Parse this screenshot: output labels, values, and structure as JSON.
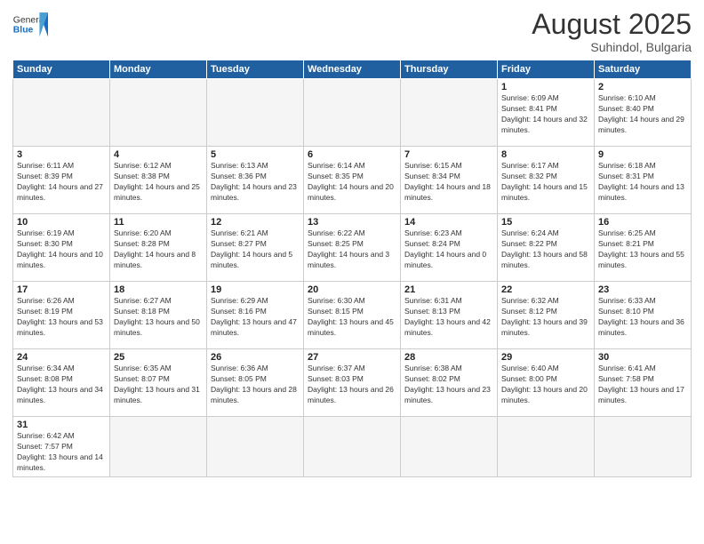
{
  "header": {
    "logo_general": "General",
    "logo_blue": "Blue",
    "month_year": "August 2025",
    "location": "Suhindol, Bulgaria"
  },
  "weekdays": [
    "Sunday",
    "Monday",
    "Tuesday",
    "Wednesday",
    "Thursday",
    "Friday",
    "Saturday"
  ],
  "weeks": [
    [
      {
        "day": "",
        "info": ""
      },
      {
        "day": "",
        "info": ""
      },
      {
        "day": "",
        "info": ""
      },
      {
        "day": "",
        "info": ""
      },
      {
        "day": "",
        "info": ""
      },
      {
        "day": "1",
        "info": "Sunrise: 6:09 AM\nSunset: 8:41 PM\nDaylight: 14 hours and 32 minutes."
      },
      {
        "day": "2",
        "info": "Sunrise: 6:10 AM\nSunset: 8:40 PM\nDaylight: 14 hours and 29 minutes."
      }
    ],
    [
      {
        "day": "3",
        "info": "Sunrise: 6:11 AM\nSunset: 8:39 PM\nDaylight: 14 hours and 27 minutes."
      },
      {
        "day": "4",
        "info": "Sunrise: 6:12 AM\nSunset: 8:38 PM\nDaylight: 14 hours and 25 minutes."
      },
      {
        "day": "5",
        "info": "Sunrise: 6:13 AM\nSunset: 8:36 PM\nDaylight: 14 hours and 23 minutes."
      },
      {
        "day": "6",
        "info": "Sunrise: 6:14 AM\nSunset: 8:35 PM\nDaylight: 14 hours and 20 minutes."
      },
      {
        "day": "7",
        "info": "Sunrise: 6:15 AM\nSunset: 8:34 PM\nDaylight: 14 hours and 18 minutes."
      },
      {
        "day": "8",
        "info": "Sunrise: 6:17 AM\nSunset: 8:32 PM\nDaylight: 14 hours and 15 minutes."
      },
      {
        "day": "9",
        "info": "Sunrise: 6:18 AM\nSunset: 8:31 PM\nDaylight: 14 hours and 13 minutes."
      }
    ],
    [
      {
        "day": "10",
        "info": "Sunrise: 6:19 AM\nSunset: 8:30 PM\nDaylight: 14 hours and 10 minutes."
      },
      {
        "day": "11",
        "info": "Sunrise: 6:20 AM\nSunset: 8:28 PM\nDaylight: 14 hours and 8 minutes."
      },
      {
        "day": "12",
        "info": "Sunrise: 6:21 AM\nSunset: 8:27 PM\nDaylight: 14 hours and 5 minutes."
      },
      {
        "day": "13",
        "info": "Sunrise: 6:22 AM\nSunset: 8:25 PM\nDaylight: 14 hours and 3 minutes."
      },
      {
        "day": "14",
        "info": "Sunrise: 6:23 AM\nSunset: 8:24 PM\nDaylight: 14 hours and 0 minutes."
      },
      {
        "day": "15",
        "info": "Sunrise: 6:24 AM\nSunset: 8:22 PM\nDaylight: 13 hours and 58 minutes."
      },
      {
        "day": "16",
        "info": "Sunrise: 6:25 AM\nSunset: 8:21 PM\nDaylight: 13 hours and 55 minutes."
      }
    ],
    [
      {
        "day": "17",
        "info": "Sunrise: 6:26 AM\nSunset: 8:19 PM\nDaylight: 13 hours and 53 minutes."
      },
      {
        "day": "18",
        "info": "Sunrise: 6:27 AM\nSunset: 8:18 PM\nDaylight: 13 hours and 50 minutes."
      },
      {
        "day": "19",
        "info": "Sunrise: 6:29 AM\nSunset: 8:16 PM\nDaylight: 13 hours and 47 minutes."
      },
      {
        "day": "20",
        "info": "Sunrise: 6:30 AM\nSunset: 8:15 PM\nDaylight: 13 hours and 45 minutes."
      },
      {
        "day": "21",
        "info": "Sunrise: 6:31 AM\nSunset: 8:13 PM\nDaylight: 13 hours and 42 minutes."
      },
      {
        "day": "22",
        "info": "Sunrise: 6:32 AM\nSunset: 8:12 PM\nDaylight: 13 hours and 39 minutes."
      },
      {
        "day": "23",
        "info": "Sunrise: 6:33 AM\nSunset: 8:10 PM\nDaylight: 13 hours and 36 minutes."
      }
    ],
    [
      {
        "day": "24",
        "info": "Sunrise: 6:34 AM\nSunset: 8:08 PM\nDaylight: 13 hours and 34 minutes."
      },
      {
        "day": "25",
        "info": "Sunrise: 6:35 AM\nSunset: 8:07 PM\nDaylight: 13 hours and 31 minutes."
      },
      {
        "day": "26",
        "info": "Sunrise: 6:36 AM\nSunset: 8:05 PM\nDaylight: 13 hours and 28 minutes."
      },
      {
        "day": "27",
        "info": "Sunrise: 6:37 AM\nSunset: 8:03 PM\nDaylight: 13 hours and 26 minutes."
      },
      {
        "day": "28",
        "info": "Sunrise: 6:38 AM\nSunset: 8:02 PM\nDaylight: 13 hours and 23 minutes."
      },
      {
        "day": "29",
        "info": "Sunrise: 6:40 AM\nSunset: 8:00 PM\nDaylight: 13 hours and 20 minutes."
      },
      {
        "day": "30",
        "info": "Sunrise: 6:41 AM\nSunset: 7:58 PM\nDaylight: 13 hours and 17 minutes."
      }
    ],
    [
      {
        "day": "31",
        "info": "Sunrise: 6:42 AM\nSunset: 7:57 PM\nDaylight: 13 hours and 14 minutes."
      },
      {
        "day": "",
        "info": ""
      },
      {
        "day": "",
        "info": ""
      },
      {
        "day": "",
        "info": ""
      },
      {
        "day": "",
        "info": ""
      },
      {
        "day": "",
        "info": ""
      },
      {
        "day": "",
        "info": ""
      }
    ]
  ]
}
